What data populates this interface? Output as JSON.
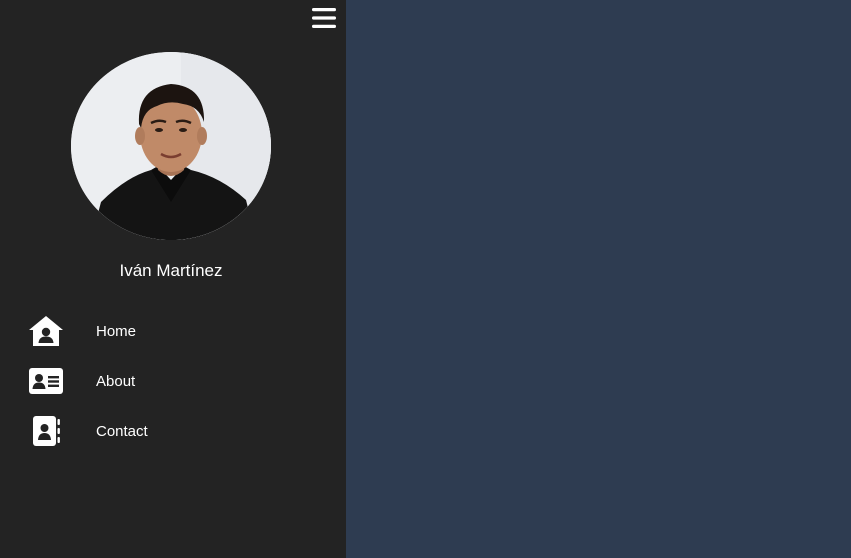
{
  "sidebar": {
    "menu_toggle_icon": "hamburger-icon",
    "profile": {
      "name": "Iván Martínez",
      "avatar": "profile-photo"
    },
    "nav": [
      {
        "label": "Home",
        "icon": "home-user-icon"
      },
      {
        "label": "About",
        "icon": "id-card-icon"
      },
      {
        "label": "Contact",
        "icon": "address-book-icon"
      }
    ],
    "background": "#232323"
  },
  "main": {
    "background": "#2e3c51"
  }
}
